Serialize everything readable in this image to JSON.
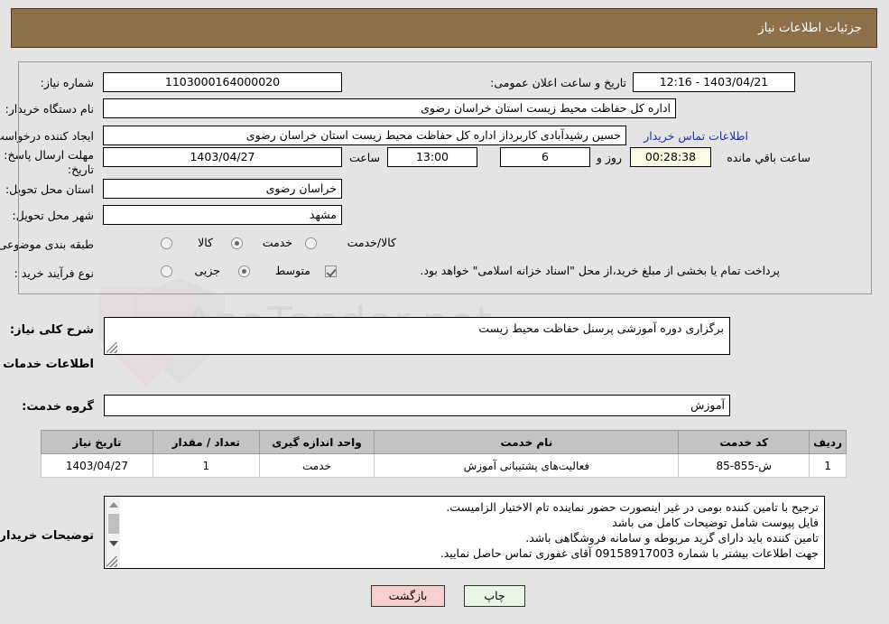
{
  "header": {
    "title": "جزئیات اطلاعات نیاز"
  },
  "fields": {
    "need_number_label": "شماره نیاز:",
    "need_number_value": "1103000164000020",
    "public_announce_label": "تاریخ و ساعت اعلان عمومی:",
    "public_announce_value": "1403/04/21 - 12:16",
    "buyer_org_label": "نام دستگاه خریدار:",
    "buyer_org_value": "اداره کل حفاظت محیط زیست استان خراسان رضوی",
    "requester_label": "ایجاد کننده درخواست:",
    "requester_value": "حسین رشیدآبادی کاربرداز اداره کل حفاظت محیط زیست استان خراسان رضوی",
    "buyer_contact_link": "اطلاعات تماس خریدار",
    "deadline_label_line1": "مهلت ارسال پاسخ: تا",
    "deadline_label_line2": "تاریخ:",
    "deadline_date": "1403/04/27",
    "deadline_hour_label": "ساعت",
    "deadline_hour": "13:00",
    "remaining_days": "6",
    "remaining_days_unit": "روز و",
    "remaining_time": "00:28:38",
    "remaining_time_unit": "ساعت باقي مانده",
    "province_label": "استان محل تحویل:",
    "province_value": "خراسان رضوی",
    "city_label": "شهر محل تحویل:",
    "city_value": "مشهد",
    "category_label": "طبقه بندی موضوعی:",
    "process_label": "نوع فرآیند خرید :",
    "treasury_note": "پرداخت تمام یا بخشی از مبلغ خرید،از محل \"اسناد خزانه اسلامی\" خواهد بود."
  },
  "category_options": [
    {
      "label": "کالا",
      "selected": false
    },
    {
      "label": "خدمت",
      "selected": true
    },
    {
      "label": "کالا/خدمت",
      "selected": false
    }
  ],
  "process_options": [
    {
      "label": "جزیی",
      "selected": false
    },
    {
      "label": "متوسط",
      "selected": true
    }
  ],
  "treasury_checkbox_checked": true,
  "sections": {
    "summary_label": "شرح کلی نیاز:",
    "summary_value": "برگزاری دوره آموزشی پرسنل حفاظت محیط زیست",
    "services_heading": "اطلاعات خدمات مورد نیاز",
    "service_group_label": "گروه خدمت:",
    "service_group_value": "آموزش",
    "buyer_notes_label": "توضیحات خریدار:",
    "buyer_notes_lines": [
      "ترجیح با تامین کننده بومی در غیر اینصورت حضور نماینده تام الاختیار الزامیست.",
      "فایل پیوست شامل توضیحات کامل می باشد",
      "تامین کننده باید دارای گرید مربوطه و سامانه فروشگاهی باشد.",
      "جهت اطلاعات بیشتر با شماره 09158917003 آقای غفوری تماس حاصل نمایید."
    ]
  },
  "table": {
    "headers": [
      "ردیف",
      "کد خدمت",
      "نام خدمت",
      "واحد اندازه گیری",
      "تعداد / مقدار",
      "تاریخ نیاز"
    ],
    "rows": [
      {
        "row": "1",
        "code": "ش-855-85",
        "name": "فعالیت‌های پشتیبانی آموزش",
        "unit": "خدمت",
        "qty": "1",
        "date": "1403/04/27"
      }
    ]
  },
  "buttons": {
    "print": "چاپ",
    "back": "بازگشت"
  },
  "watermark": {
    "text": "AnaTender.net"
  },
  "colors": {
    "header_bg": "#8d7048",
    "page_bg": "#e4e4e4",
    "link": "#1c2fb4",
    "table_header_bg": "#c3c3c3",
    "print_btn_bg": "#e9f6e5",
    "back_btn_bg": "#f8cfcf",
    "countdown_bg": "#fbfbe3"
  }
}
